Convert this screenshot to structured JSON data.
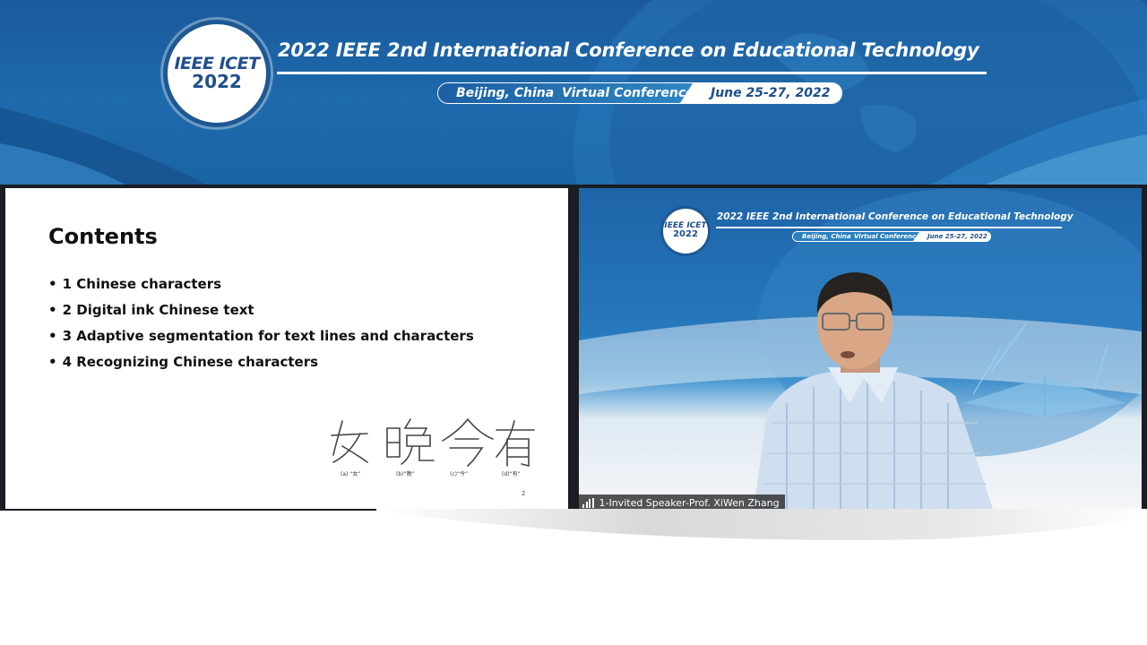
{
  "banner": {
    "logo_line1": "IEEE ICET",
    "logo_line2": "2022",
    "title": "2022 IEEE 2nd International Conference on Educational Technology",
    "location": "Beijing, China",
    "mode": "Virtual Conference",
    "dates": "June 25-27, 2022"
  },
  "slide": {
    "title": "Contents",
    "items": [
      "1 Chinese characters",
      "2 Digital ink Chinese text",
      "3 Adaptive segmentation for text lines and characters",
      "4 Recognizing Chinese characters"
    ],
    "bullet": "•",
    "captions": [
      "(a) “女”",
      "(b)“晚”",
      "(c)“今”",
      "(d)“有”"
    ],
    "page_number": "2"
  },
  "video": {
    "logo_line1": "IEEE ICET",
    "logo_line2": "2022",
    "title": "2022 IEEE 2nd International Conference on Educational Technology",
    "location": "Beijing, China",
    "mode": "Virtual Conference",
    "dates": "June 25-27, 2022",
    "participant_name": "1-Invited Speaker-Prof. XiWen Zhang",
    "signal_icon": "signal-strength-icon"
  },
  "colors": {
    "banner_blue": "#1d6aac",
    "logo_text": "#1f4f8c",
    "panel_dark": "#1a1d23"
  }
}
